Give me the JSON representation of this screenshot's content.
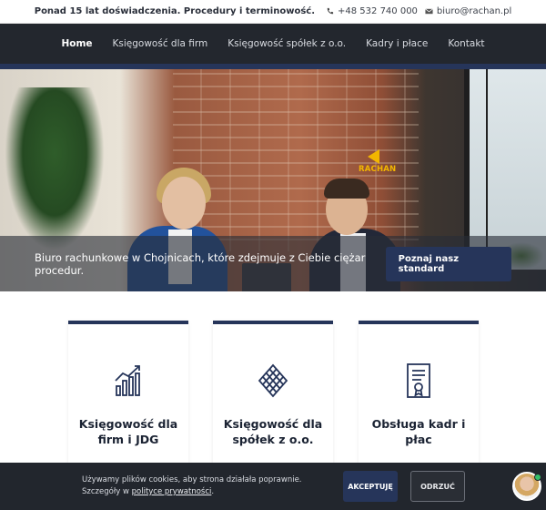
{
  "topbar": {
    "tagline": "Ponad 15 lat doświadczenia. Procedury i terminowość.",
    "phone": "+48 532 740 000",
    "email": "biuro@rachan.pl"
  },
  "nav": {
    "items": [
      {
        "label": "Home",
        "active": true
      },
      {
        "label": "Księgowość dla firm",
        "active": false
      },
      {
        "label": "Księgowość spółek z o.o.",
        "active": false
      },
      {
        "label": "Kadry i płace",
        "active": false
      },
      {
        "label": "Kontakt",
        "active": false
      }
    ]
  },
  "hero": {
    "logo_text": "RACHAN",
    "lead": "Biuro rachunkowe w Chojnicach, które zdejmuje z Ciebie ciężar procedur.",
    "cta": "Poznaj nasz standard"
  },
  "cards": [
    {
      "title": "Księgowość dla firm i JDG",
      "icon": "growth-chart-icon"
    },
    {
      "title": "Księgowość dla spółek z o.o.",
      "icon": "lattice-diamond-icon"
    },
    {
      "title": "Obsługa kadr i płac",
      "icon": "certificate-document-icon"
    }
  ],
  "cookie": {
    "message": "Używamy plików cookies, aby strona działała poprawnie. Szczegóły w",
    "policy_link": "polityce prywatności",
    "policy_suffix": ".",
    "accept": "AKCEPTUJĘ",
    "reject": "ODRZUĆ"
  },
  "colors": {
    "navy": "#26355a",
    "nav_bg": "#23272e",
    "brand_yellow": "#f2b600"
  }
}
